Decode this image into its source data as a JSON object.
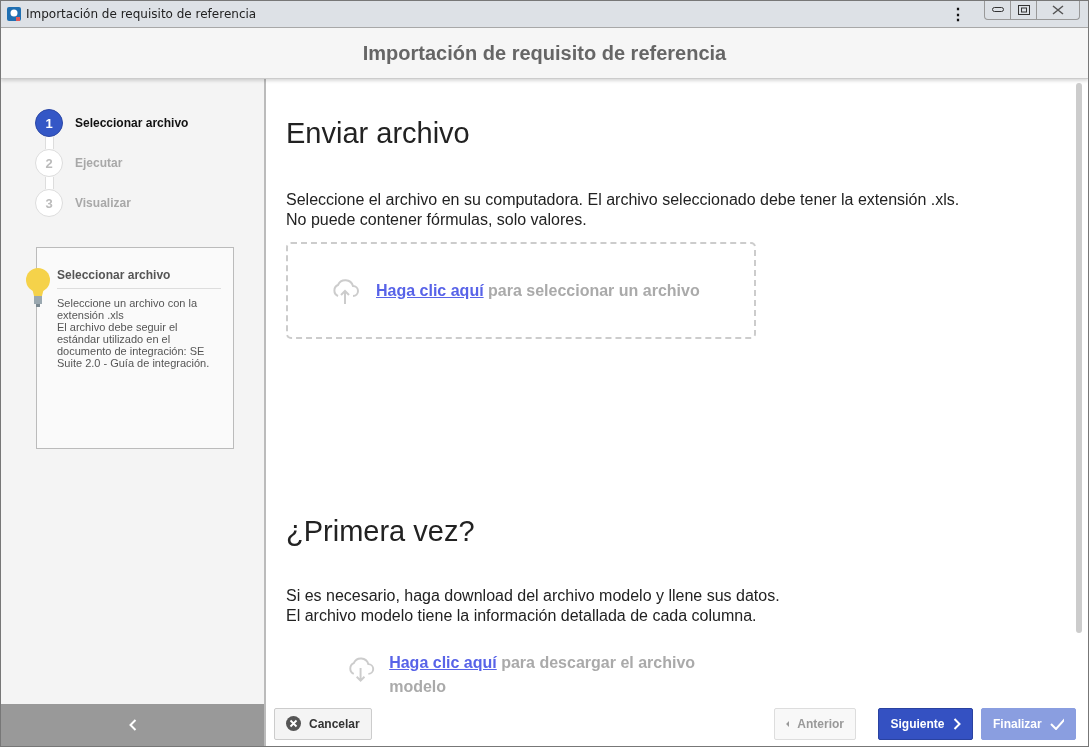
{
  "window": {
    "title": "Importación de requisito de referencia",
    "menu_icon": "⋮"
  },
  "header": {
    "title": "Importación de requisito de referencia"
  },
  "steps": [
    {
      "number": "1",
      "label": "Seleccionar archivo",
      "selected": true
    },
    {
      "number": "2",
      "label": "Ejecutar",
      "selected": false
    },
    {
      "number": "3",
      "label": "Visualizar",
      "selected": false
    }
  ],
  "help": {
    "title": "Seleccionar archivo",
    "paragraphs": [
      "Seleccione un archivo con la extensión .xls",
      "El archivo debe seguir el estándar utilizado en el documento de integración: SE Suite 2.0 - Guía de integración."
    ]
  },
  "upload": {
    "title": "Enviar archivo",
    "description": [
      "Seleccione el archivo en su computadora. El archivo seleccionado debe tener la extensión .xls.",
      "No puede contener fórmulas, solo valores."
    ],
    "link": "Haga clic aquí",
    "rest": " para seleccionar un archivo"
  },
  "first_time": {
    "title": "¿Primera vez?",
    "description": [
      "Si es necesario, haga download del archivo modelo y llene sus datos.",
      "El archivo modelo tiene la información detallada de cada columna."
    ],
    "link": "Haga clic aquí",
    "rest": " para descargar el archivo modelo"
  },
  "buttons": [
    {
      "kind": "cancel",
      "label": "Cancelar",
      "disabled": false
    },
    {
      "kind": "prev",
      "label": "Anterior",
      "disabled": true
    },
    {
      "kind": "next",
      "label": "Siguiente",
      "disabled": false
    },
    {
      "kind": "finish",
      "label": "Finalizar",
      "disabled": true
    }
  ]
}
